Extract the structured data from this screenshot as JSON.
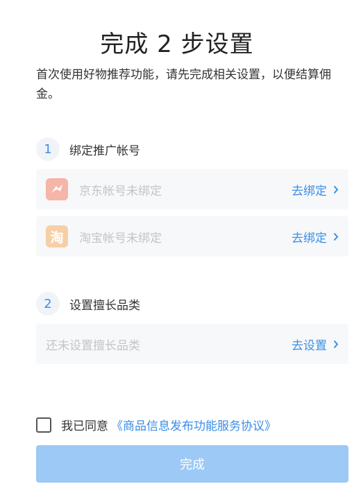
{
  "page": {
    "title": "完成 2 步设置",
    "intro": "首次使用好物推荐功能，请先完成相关设置，以便结算佣金。"
  },
  "steps": [
    {
      "number": "1",
      "title": "绑定推广帐号",
      "rows": [
        {
          "icon": "jd-icon",
          "label": "京东帐号未绑定",
          "action": "去绑定"
        },
        {
          "icon": "taobao-icon",
          "icon_text": "淘",
          "label": "淘宝帐号未绑定",
          "action": "去绑定"
        }
      ]
    },
    {
      "number": "2",
      "title": "设置擅长品类",
      "rows": [
        {
          "label": "还未设置擅长品类",
          "action": "去设置"
        }
      ]
    }
  ],
  "agreement": {
    "prefix": "我已同意",
    "link": "《商品信息发布功能服务协议》",
    "checked": false
  },
  "done_button": {
    "label": "完成"
  },
  "colors": {
    "accent": "#3a8ee6",
    "button_disabled": "#9cc9f5",
    "jd_icon": "#f5b5a8",
    "taobao_icon": "#f7cfa6"
  }
}
